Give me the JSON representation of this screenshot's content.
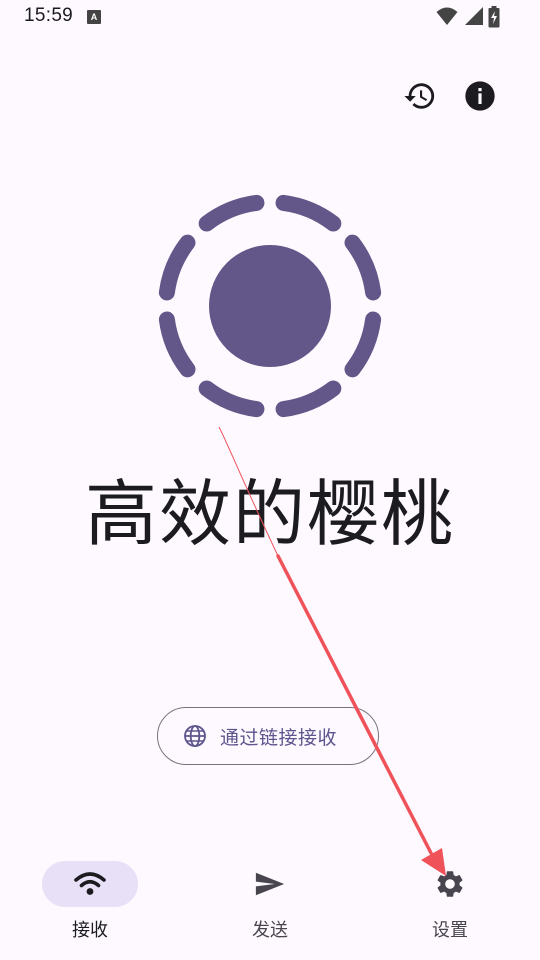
{
  "status_bar": {
    "time": "15:59",
    "notification_icon_letter": "A",
    "icons": [
      "wifi-icon",
      "signal-icon",
      "battery-charging-icon"
    ]
  },
  "top_actions": {
    "history_icon": "history-icon",
    "info_icon": "info-icon"
  },
  "app": {
    "name": "高效的樱桃",
    "logo_icon": "dashed-circle-logo"
  },
  "link_button": {
    "icon": "globe-icon",
    "label": "通过链接接收"
  },
  "bottom_nav": {
    "items": [
      {
        "label": "接收",
        "icon": "wifi-icon",
        "selected": true
      },
      {
        "label": "发送",
        "icon": "send-icon",
        "selected": false
      },
      {
        "label": "设置",
        "icon": "gear-icon",
        "selected": false
      }
    ]
  },
  "colors": {
    "background": "#fdf9fe",
    "accent": "#635689",
    "indicator": "#e7e0f7",
    "annotation_arrow": "#f0525a"
  }
}
